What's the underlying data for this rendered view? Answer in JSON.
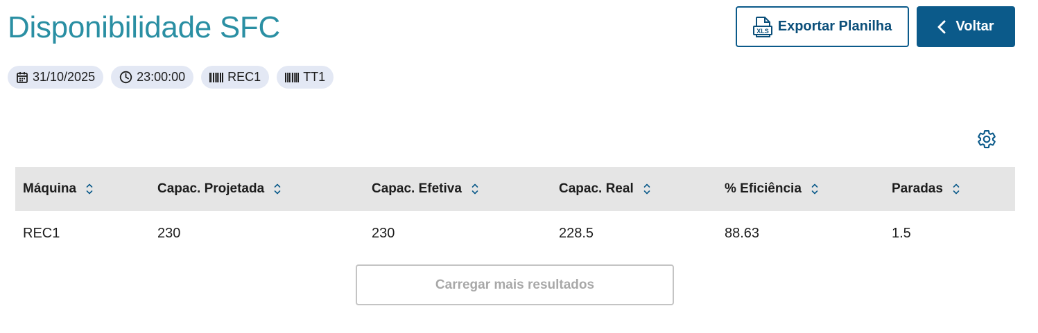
{
  "header": {
    "title": "Disponibilidade SFC",
    "export_label": "Exportar Planilha",
    "export_icon_text": "XLS",
    "back_label": "Voltar"
  },
  "filters": [
    {
      "icon": "calendar-icon",
      "label": "31/10/2025"
    },
    {
      "icon": "clock-icon",
      "label": "23:00:00"
    },
    {
      "icon": "barcode-icon",
      "label": "REC1"
    },
    {
      "icon": "barcode-icon",
      "label": "TT1"
    }
  ],
  "table": {
    "columns": [
      "Máquina",
      "Capac. Projetada",
      "Capac. Efetiva",
      "Capac. Real",
      "% Eficiência",
      "Paradas"
    ],
    "rows": [
      [
        "REC1",
        "230",
        "230",
        "228.5",
        "88.63",
        "1.5"
      ]
    ]
  },
  "load_more_label": "Carregar mais resultados",
  "colors": {
    "title": "#2a8fa3",
    "primary": "#0b5a8a",
    "chip_bg": "#e3e8f4",
    "header_bg": "#e5e5e5",
    "disabled_text": "#a8a8a8"
  }
}
